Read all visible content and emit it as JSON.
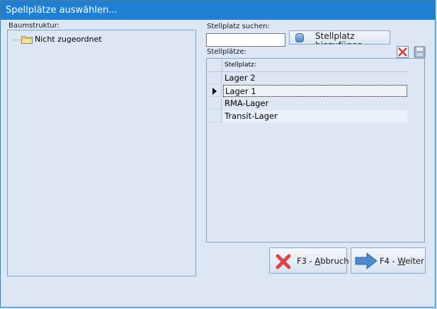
{
  "window": {
    "title": "Spellplätze auswählen..."
  },
  "tree": {
    "label": "Baumstruktur:",
    "items": [
      {
        "label": "Nicht zugeordnet",
        "icon": "folder-icon"
      }
    ]
  },
  "search": {
    "label": "Stellplatz suchen:",
    "value": ""
  },
  "add_button": {
    "label": "Stellplatz hinzufügen"
  },
  "grid": {
    "label": "Stellplätze:",
    "column_header": "Stellplatz:",
    "rows": [
      "Lager 2",
      "Lager 1",
      "RMA-Lager",
      "Transit-Lager"
    ],
    "selected_index": 1
  },
  "icons": {
    "delete": "delete-red-x-icon",
    "save": "save-disk-icon"
  },
  "buttons": {
    "cancel": {
      "prefix": "F3 - ",
      "accel": "A",
      "rest": "bbruch"
    },
    "next": {
      "prefix": "F4 - ",
      "accel": "W",
      "rest": "eiter"
    }
  },
  "colors": {
    "titlebar": "#1e7fd3",
    "background": "#dce7f3",
    "cancel_x": "#e04343",
    "next_arrow": "#4a8ccc"
  }
}
